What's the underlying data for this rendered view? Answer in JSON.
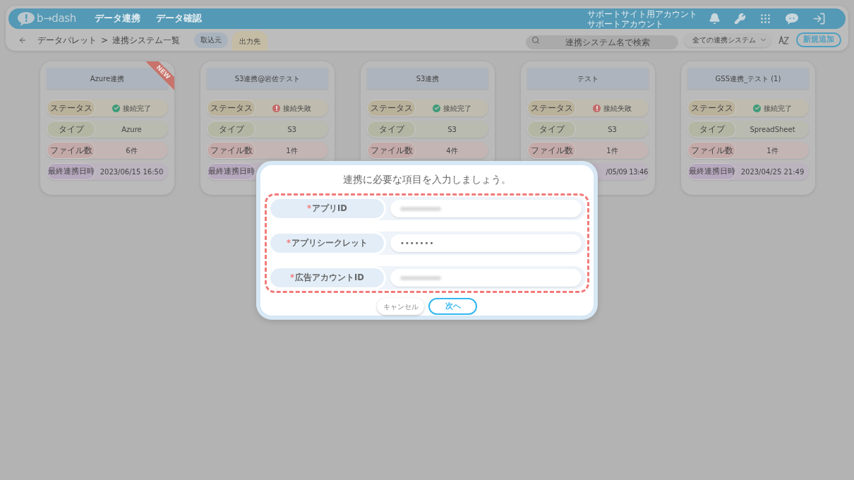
{
  "header": {
    "logo": "b→dash",
    "nav": [
      "データ連携",
      "データ確認"
    ],
    "account": [
      "サポートサイト用アカウント",
      "サポートアカウント"
    ]
  },
  "toolbar": {
    "breadcrumb": [
      "データパレット",
      ">",
      "連携システム一覧"
    ],
    "tabs": [
      {
        "label": "取込元",
        "selected": false
      },
      {
        "label": "出力先",
        "selected": true
      }
    ],
    "search": {
      "placeholder": "連携システム名で検索"
    },
    "filter": "全ての連携システム",
    "add_button": "新規追加"
  },
  "cards": [
    {
      "title": "Azure連携",
      "badge": "NEW",
      "rows": [
        {
          "kind": "status",
          "label": "ステータス",
          "value": "接続完了",
          "connected": true
        },
        {
          "kind": "type",
          "label": "タイプ",
          "value": "Azure"
        },
        {
          "kind": "files",
          "label": "ファイル数",
          "value": "6件"
        },
        {
          "kind": "date",
          "label": "最終連携日時",
          "value": "2023/06/15 16:50"
        }
      ]
    },
    {
      "title": "S3連携@岩佐テスト",
      "rows": [
        {
          "kind": "status",
          "label": "ステータス",
          "value": "接続失敗",
          "connected": false
        },
        {
          "kind": "type",
          "label": "タイプ",
          "value": "S3"
        },
        {
          "kind": "files",
          "label": "ファイル数",
          "value": "1件"
        },
        {
          "kind": "date",
          "label": "最終連携日時"
        }
      ]
    },
    {
      "title": "S3連携",
      "rows": [
        {
          "kind": "status",
          "label": "ステータス",
          "value": "接続完了",
          "connected": true
        },
        {
          "kind": "type",
          "label": "タイプ",
          "value": "S3"
        },
        {
          "kind": "files",
          "label": "ファイル数",
          "value": "4件"
        }
      ]
    },
    {
      "title": "テスト",
      "rows": [
        {
          "kind": "status",
          "label": "ステータス",
          "value": "接続失敗",
          "connected": false
        },
        {
          "kind": "type",
          "label": "タイプ",
          "value": "S3"
        },
        {
          "kind": "files",
          "label": "ファイル数",
          "value": "1件"
        },
        {
          "kind": "date",
          "value": "/05/09 13:46"
        }
      ]
    },
    {
      "title": "GSS連携_テスト (1)",
      "rows": [
        {
          "kind": "status",
          "label": "ステータス",
          "value": "接続完了",
          "connected": true
        },
        {
          "kind": "type",
          "label": "タイプ",
          "value": "SpreadSheet"
        },
        {
          "kind": "files",
          "label": "ファイル数",
          "value": "1件"
        },
        {
          "kind": "date",
          "label": "最終連携日時",
          "value": "2023/04/25 21:49"
        }
      ]
    }
  ],
  "dialog": {
    "title": "連携に必要な項目を入力しましょう。",
    "fields": [
      {
        "label": "アプリID",
        "required_mark": "*",
        "redacted": true
      },
      {
        "label": "アプリシークレット",
        "required_mark": "*",
        "value": "•••••••"
      },
      {
        "label": "広告アカウントID",
        "required_mark": "*",
        "redacted": true
      }
    ],
    "buttons": [
      {
        "label": "キャンセル",
        "kind": "secondary"
      },
      {
        "label": "次へ",
        "kind": "primary"
      }
    ]
  }
}
